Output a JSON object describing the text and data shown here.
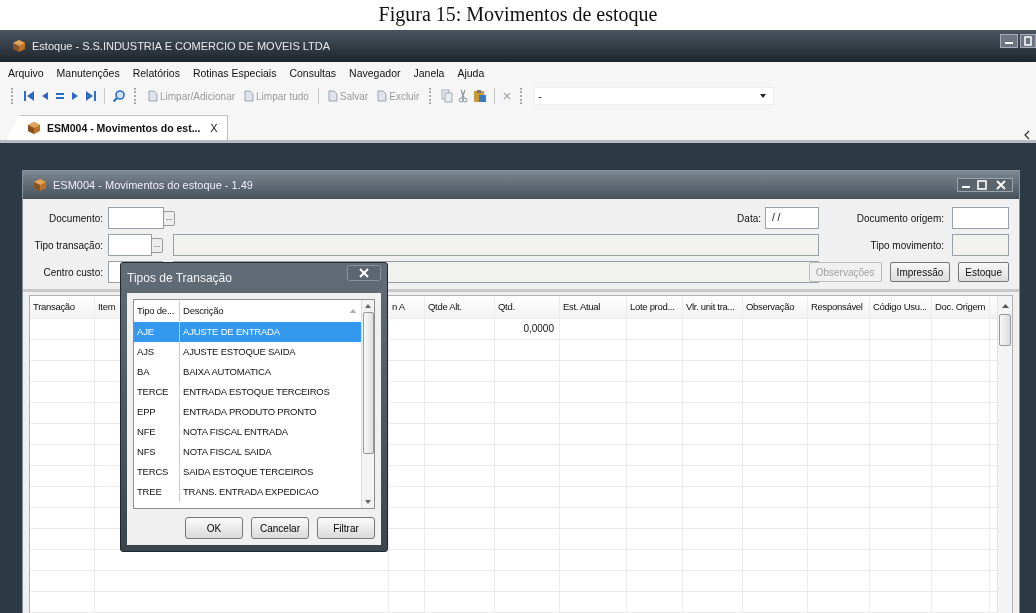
{
  "caption": "Figura 15: Movimentos de estoque",
  "window": {
    "title": "Estoque - S.S.INDUSTRIA E COMERCIO DE MOVEIS LTDA"
  },
  "menu": [
    "Arquivo",
    "Manutenções",
    "Relatórios",
    "Rotinas Especiais",
    "Consultas",
    "Navegador",
    "Janela",
    "Ajuda"
  ],
  "toolbar": {
    "buttons": [
      {
        "label": "Limpar/Adicionar",
        "disabled": true
      },
      {
        "label": "Limpar tudo",
        "disabled": true
      },
      {
        "label": "Salvar",
        "disabled": true
      },
      {
        "label": "Excluir",
        "disabled": true
      }
    ],
    "combo": {
      "value": "-"
    }
  },
  "tabs": [
    {
      "label": "ESM004 - Movimentos do est...",
      "close": "X",
      "selected": true
    }
  ],
  "form_window": {
    "title": "ESM004 - Movimentos do estoque - 1.49",
    "documento": {
      "label": "Documento:",
      "lookup": "..."
    },
    "tipo_transacao": {
      "label": "Tipo transação:",
      "lookup": "..."
    },
    "centro_custo": {
      "label": "Centro custo:"
    },
    "data": {
      "label": "Data:",
      "value": "/ /"
    },
    "documento_origem": {
      "label": "Documento origem:"
    },
    "tipo_movimento": {
      "label": "Tipo movimento:"
    },
    "buttons": [
      {
        "label": "Observações",
        "disabled": true
      },
      {
        "label": "Impressão",
        "disabled": false
      },
      {
        "label": "Estoque",
        "disabled": false
      }
    ]
  },
  "grid": {
    "columns": [
      "Transação",
      "Item",
      "n A",
      "Qtde Alt.",
      "Qtd.",
      "Est. Atual",
      "Lote prod...",
      "Vlr. unit tra...",
      "Observação",
      "Responsável",
      "Código Usu...",
      "Doc. Origem"
    ],
    "rows": [
      {
        "qtd": "0,0000"
      }
    ]
  },
  "dialog": {
    "title": "Tipos de Transação",
    "columns": [
      "Tipo de...",
      "Descrição"
    ],
    "rows": [
      {
        "code": "AJE",
        "description": "AJUSTE DE ENTRADA",
        "selected": true
      },
      {
        "code": "AJS",
        "description": "AJUSTE ESTOQUE SAIDA",
        "selected": false
      },
      {
        "code": "BA",
        "description": "BAIXA AUTOMATICA",
        "selected": false
      },
      {
        "code": "TERCE",
        "description": "ENTRADA ESTOQUE TERCEIROS",
        "selected": false
      },
      {
        "code": "EPP",
        "description": "ENTRADA PRODUTO PRONTO",
        "selected": false
      },
      {
        "code": "NFE",
        "description": "NOTA FISCAL ENTRADA",
        "selected": false
      },
      {
        "code": "NFS",
        "description": "NOTA FISCAL SAIDA",
        "selected": false
      },
      {
        "code": "TERCS",
        "description": "SAIDA ESTOQUE TERCEIROS",
        "selected": false
      },
      {
        "code": "TREE",
        "description": "TRANS. ENTRADA EXPEDICAO",
        "selected": false
      }
    ],
    "buttons": [
      "OK",
      "Cancelar",
      "Filtrar"
    ]
  }
}
